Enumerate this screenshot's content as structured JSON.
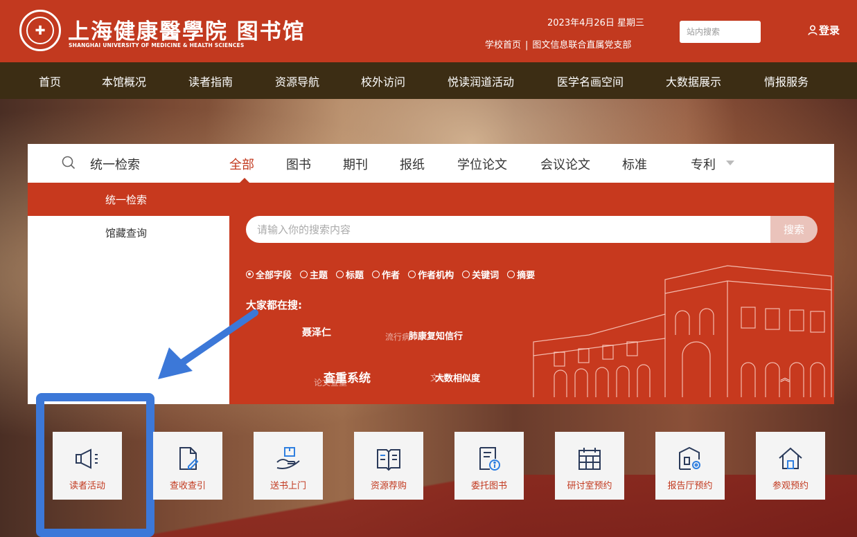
{
  "header": {
    "logo_cn": "上海健康醫學院 图书馆",
    "logo_en": "SHANGHAI UNIVERSITY OF MEDICINE & HEALTH SCIENCES",
    "date": "2023年4月26日 星期三",
    "links": [
      "学校首页",
      "图文信息联合直属党支部"
    ],
    "link_sep": "|",
    "site_search_placeholder": "站内搜索",
    "login": "登录"
  },
  "nav": [
    "首页",
    "本馆概况",
    "读者指南",
    "资源导航",
    "校外访问",
    "悦读润道活动",
    "医学名画空间",
    "大数据展示",
    "情报服务"
  ],
  "search": {
    "title": "统一检索",
    "tabs": [
      "全部",
      "图书",
      "期刊",
      "报纸",
      "学位论文",
      "会议论文",
      "标准",
      "专利"
    ],
    "active_tab": "全部",
    "side_items": [
      "统一检索",
      "馆藏查询"
    ],
    "placeholder": "请输入你的搜索内容",
    "button": "搜索",
    "fields": [
      "全部字段",
      "主题",
      "标题",
      "作者",
      "作者机构",
      "关键词",
      "摘要"
    ],
    "selected_field": "全部字段",
    "hot_title": "大家都在搜:",
    "hot_terms": [
      "聂泽仁",
      "流行病",
      "肺康复知信行",
      "查重系统",
      "论文查重",
      "文献",
      "大数相似度"
    ]
  },
  "tiles": [
    "读者活动",
    "查收查引",
    "送书上门",
    "资源荐购",
    "委托图书",
    "研讨室预约",
    "报告厅预约",
    "参观预约"
  ],
  "tile_icons": [
    "megaphone-icon",
    "document-edit-icon",
    "hand-box-icon",
    "open-book-icon",
    "document-info-icon",
    "calendar-grid-icon",
    "building-gear-icon",
    "home-icon"
  ],
  "colors": {
    "brand_red": "#c2391f",
    "nav_brown": "#3c2d14",
    "highlight_blue": "#3c78d8"
  }
}
